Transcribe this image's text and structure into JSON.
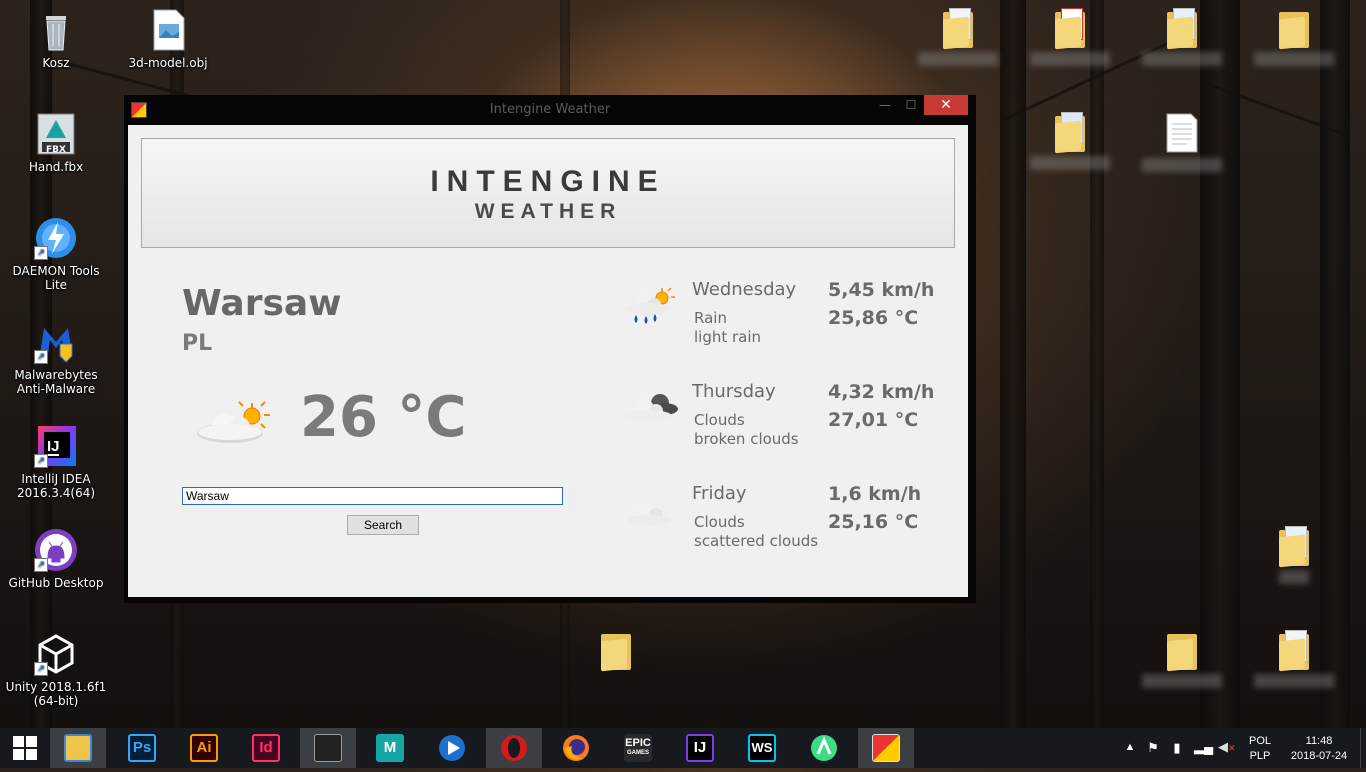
{
  "desktop": {
    "icons": [
      {
        "label": "Kosz"
      },
      {
        "label": "3d-model.obj"
      },
      {
        "label": "Hand.fbx"
      },
      {
        "label": "DAEMON Tools Lite"
      },
      {
        "label": "Malwarebytes Anti-Malware"
      },
      {
        "label": "IntelliJ IDEA 2016.3.4(64)"
      },
      {
        "label": "GitHub Desktop"
      },
      {
        "label": "Unity 2018.1.6f1 (64-bit)"
      }
    ],
    "fbx_badge": "FBX"
  },
  "window": {
    "title": "Intengine Weather",
    "close_glyph": "✕",
    "min_glyph": "—",
    "max_glyph": "☐"
  },
  "app": {
    "banner_line1": "INTENGINE",
    "banner_line2": "WEATHER",
    "city": "Warsaw",
    "country": "PL",
    "current_temp": "26 °C",
    "current_icon": "sun-behind-cloud-icon",
    "search_value": "Warsaw",
    "search_button": "Search",
    "forecast": [
      {
        "day": "Wednesday",
        "main": "Rain",
        "description": "light rain",
        "wind": "5,45 km/h",
        "temp": "25,86 °C",
        "icon": "rain-cloud-sun-icon"
      },
      {
        "day": "Thursday",
        "main": "Clouds",
        "description": "broken clouds",
        "wind": "4,32 km/h",
        "temp": "27,01 °C",
        "icon": "broken-clouds-icon"
      },
      {
        "day": "Friday",
        "main": "Clouds",
        "description": "scattered clouds",
        "wind": "1,6 km/h",
        "temp": "25,16 °C",
        "icon": "scattered-clouds-icon"
      }
    ]
  },
  "taskbar": {
    "apps": [
      "Ps",
      "Ai",
      "Id",
      "M",
      "IJ",
      "WS"
    ],
    "epic_line1": "EPIC",
    "epic_line2": "GAMES",
    "language_top": "POL",
    "language_bottom": "PLP",
    "time": "11:48",
    "date": "2018-07-24",
    "accent": "#c73a37"
  }
}
